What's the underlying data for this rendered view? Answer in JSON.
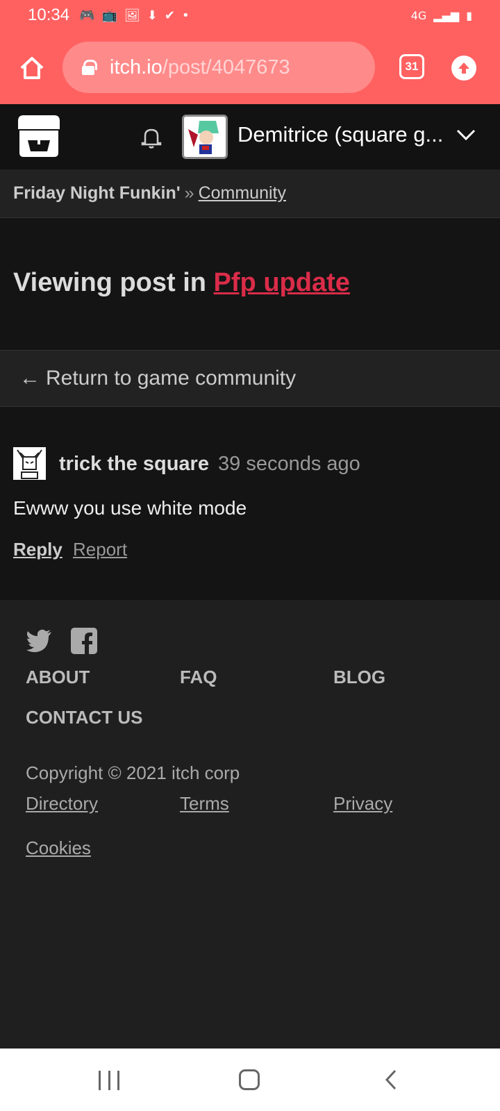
{
  "status_bar": {
    "time": "10:34",
    "network": "4G"
  },
  "browser": {
    "url_host": "itch.io",
    "url_path": "/post/4047673",
    "tab_count": "31"
  },
  "header": {
    "user_name": "Demitrice (square g..."
  },
  "breadcrumb": {
    "game": "Friday Night Funkin'",
    "separator": "»",
    "community": "Community"
  },
  "title": {
    "prefix": "Viewing post in ",
    "topic": "Pfp update"
  },
  "return_link": {
    "arrow": "←",
    "label": "Return to game community"
  },
  "post": {
    "author": "trick the square",
    "time": "39 seconds ago",
    "body": "Ewww you use white mode",
    "reply": "Reply",
    "report": "Report"
  },
  "footer": {
    "nav": [
      "ABOUT",
      "FAQ",
      "BLOG",
      "CONTACT US"
    ],
    "copyright": "Copyright © 2021 itch corp",
    "links": [
      "Directory",
      "Terms",
      "Privacy",
      "Cookies"
    ]
  },
  "colors": {
    "brand": "#ff6161",
    "accent_link": "#da2c49",
    "background": "#1b1b1b"
  }
}
